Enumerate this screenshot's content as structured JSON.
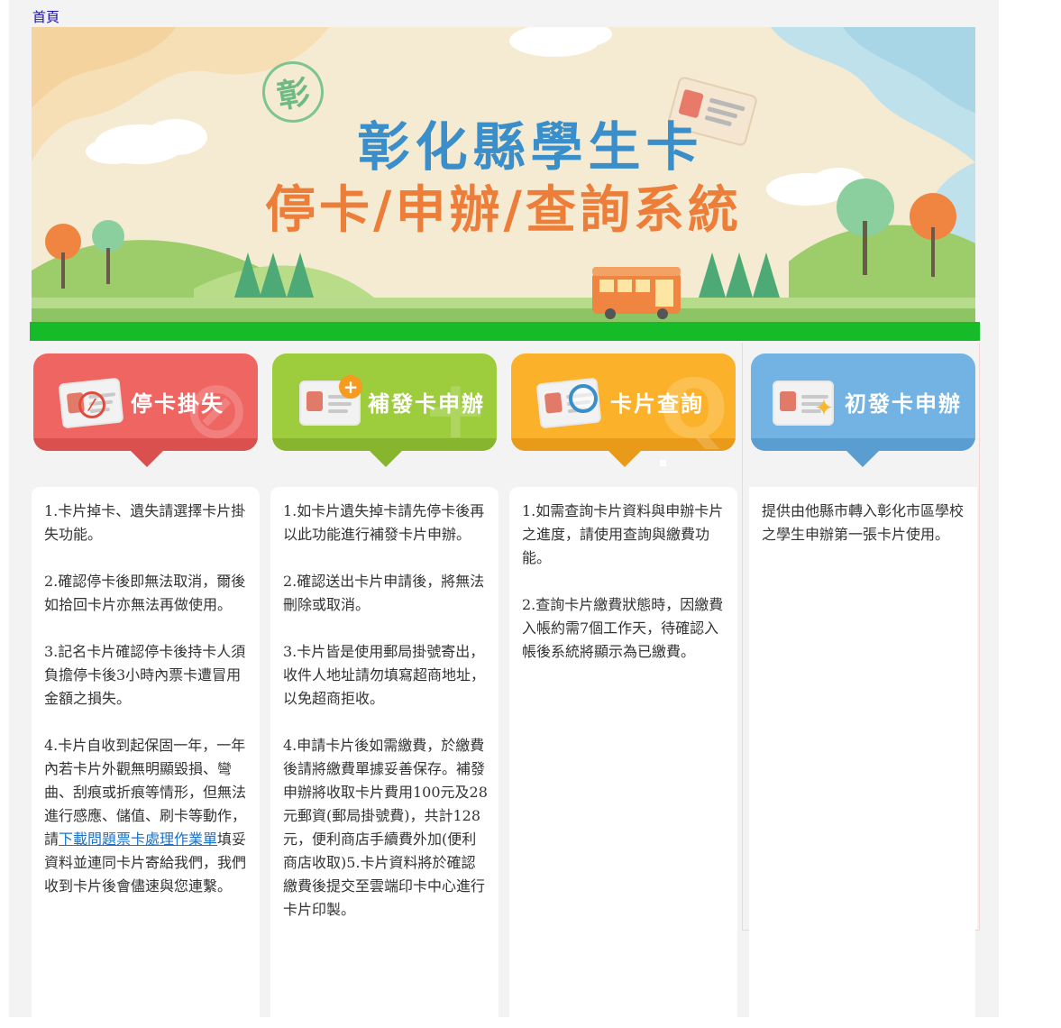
{
  "nav": {
    "home_label": "首頁"
  },
  "banner": {
    "seal_char": "彰",
    "title_line1": "彰化縣學生卡",
    "title_line2": "停卡/申辦/查詢系統"
  },
  "tabs": [
    {
      "label": "停卡掛失",
      "color": "#ef6562",
      "shade": "#d9504e"
    },
    {
      "label": "補發卡申辦",
      "color": "#9dcc3c",
      "shade": "#87b52e"
    },
    {
      "label": "卡片查詢",
      "color": "#fbb22a",
      "shade": "#e89a18"
    },
    {
      "label": "初發卡申辦",
      "color": "#72b3e4",
      "shade": "#5a9dd0"
    }
  ],
  "panels": {
    "stop": {
      "p1": "1.卡片掉卡、遺失請選擇卡片掛失功能。",
      "p2": "2.確認停卡後即無法取消，爾後如拾回卡片亦無法再做使用。",
      "p3": "3.記名卡片確認停卡後持卡人須負擔停卡後3小時內票卡遭冒用金額之損失。",
      "p4_before": "4.卡片自收到起保固一年，一年內若卡片外觀無明顯毀損、彎曲、刮痕或折痕等情形，但無法進行感應、儲值、刷卡等動作，請",
      "p4_link": "下載問題票卡處理作業單",
      "p4_after": "填妥資料並連同卡片寄給我們，我們收到卡片後會儘速與您連繫。"
    },
    "reissue": {
      "p1": "1.如卡片遺失掉卡請先停卡後再以此功能進行補發卡片申辦。",
      "p2": "2.確認送出卡片申請後，將無法刪除或取消。",
      "p3": "3.卡片皆是使用郵局掛號寄出，收件人地址請勿填寫超商地址，以免超商拒收。",
      "p4": "4.申請卡片後如需繳費，於繳費後請將繳費單據妥善保存。補發申辦將收取卡片費用100元及28元郵資(郵局掛號費)，共計128元，便利商店手續費外加(便利商店收取)5.卡片資料將於確認繳費後提交至雲端印卡中心進行卡片印製。"
    },
    "query": {
      "p1": "1.如需查詢卡片資料與申辦卡片之進度，請使用查詢與繳費功能。",
      "p2": "2.查詢卡片繳費狀態時，因繳費入帳約需7個工作天，待確認入帳後系統將顯示為已繳費。"
    },
    "first": {
      "p1": "提供由他縣市轉入彰化市區學校之學生申辦第一張卡片使用。"
    }
  }
}
